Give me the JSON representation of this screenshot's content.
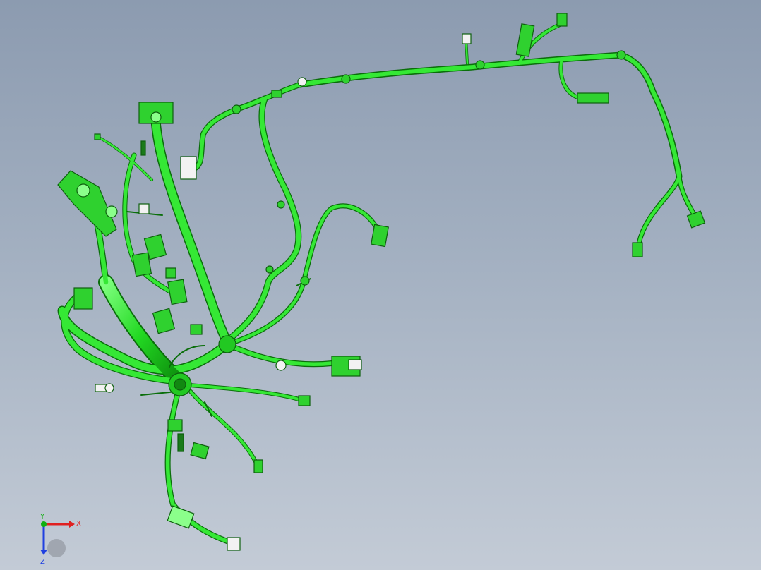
{
  "colors": {
    "wire": "#33e633",
    "wire_dark": "#0a6e0a",
    "wire_highlight": "#8bff8b",
    "connector": "#2fd12f",
    "connector_dark": "#0e5f0e",
    "white_part": "#f2f2f2",
    "axis_x": "#e02020",
    "axis_y": "#10b010",
    "axis_z": "#2040e0"
  },
  "triad": {
    "x_label": "X",
    "y_label": "Y",
    "z_label": "Z"
  },
  "icons": {
    "view_triad": "coordinate-triad-icon"
  }
}
